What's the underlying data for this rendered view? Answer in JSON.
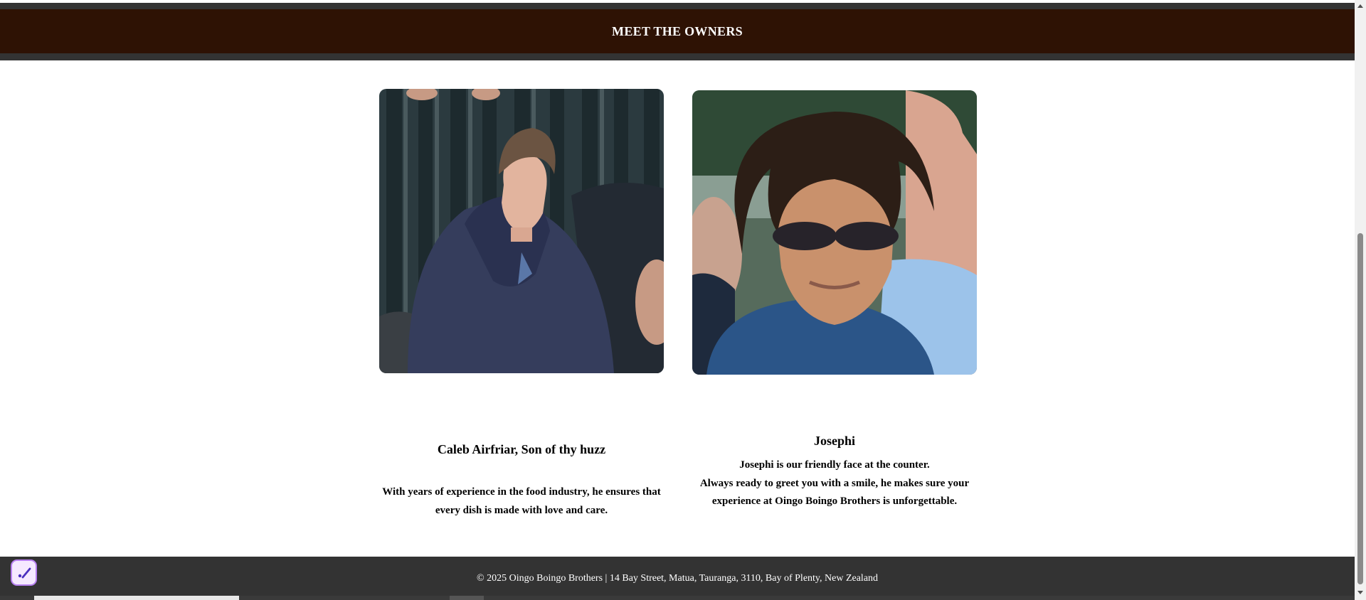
{
  "section": {
    "title": "MEET THE OWNERS"
  },
  "owners": [
    {
      "name": "Caleb Airfriar, Son of thy huzz",
      "description": "With years of experience in the food industry, he ensures that every dish is made with love and care."
    },
    {
      "name": "Josephi",
      "description_lines": [
        "Josephi is our friendly face at the counter.",
        "Always ready to greet you with a smile, he makes sure your experience at Oingo Boingo Brothers is unforgettable."
      ]
    }
  ],
  "footer": {
    "text": "© 2025 Oingo Boingo Brothers | 14 Bay Street, Matua, Tauranga, 3110, Bay of Plenty, New Zealand"
  },
  "icons": {
    "widget": "checkmark-edit-icon",
    "scroll_up": "chevron-up-icon",
    "scroll_down": "chevron-down-icon"
  },
  "colors": {
    "header_bg": "#2e1204",
    "frame_bg": "#333333",
    "widget_border": "#b780f0"
  }
}
